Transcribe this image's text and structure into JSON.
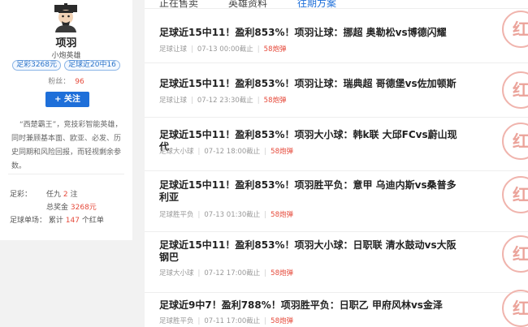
{
  "profile": {
    "name": "项羽",
    "role": "小炮英雄",
    "badges": [
      "足彩3268元",
      "足球近20中16"
    ],
    "fans_label": "粉丝：",
    "fans_count": "96",
    "follow_label": "+ 关注",
    "intro": "“西楚霸王”，竞技彩智能英雄，同时兼顾基本面、欧亚、必发、历史同期和风险回报，而轻视剩余参数。",
    "stats": {
      "zucai_label": "足彩：",
      "renjiu_prefix": "任九",
      "renjiu_count": "2",
      "renjiu_suffix": "注",
      "prize_label": "总奖金",
      "prize_value": "3268元",
      "single_label": "足球单场：",
      "single_prefix": "累计",
      "single_count": "147",
      "single_suffix": "个红单"
    }
  },
  "tabs": [
    "正在售卖",
    "英雄资料",
    "往期方案"
  ],
  "items": [
    {
      "title": "足球近15中11！盈利853%！项羽让球：挪超 奥勒松vs博德闪耀",
      "type": "足球让球",
      "time": "07-13 00:00截止",
      "price": "58炮弹",
      "stamp": "红"
    },
    {
      "title": "足球近15中11！盈利853%！项羽让球：瑞典超 哥德堡vs佐加顿斯",
      "type": "足球让球",
      "time": "07-12 23:30截止",
      "price": "58炮弹",
      "stamp": "红"
    },
    {
      "title": "足球近15中11！盈利853%！项羽大小球：韩k联 大邱FCvs蔚山现代",
      "type": "足球大小球",
      "time": "07-12 18:00截止",
      "price": "58炮弹",
      "stamp": "红"
    },
    {
      "title": "足球近15中11！盈利853%！项羽胜平负：意甲 乌迪内斯vs桑普多利亚",
      "type": "足球胜平负",
      "time": "07-13 01:30截止",
      "price": "58炮弹",
      "stamp": "红"
    },
    {
      "title": "足球近15中11！盈利853%！项羽大小球：日职联 清水鼓动vs大阪钢巴",
      "type": "足球大小球",
      "time": "07-12 17:00截止",
      "price": "58炮弹",
      "stamp": "红"
    },
    {
      "title": "足球近9中7！盈利788%！项羽胜平负：日职乙 甲府风林vs金泽",
      "type": "足球胜平负",
      "time": "07-11 17:00截止",
      "price": "58炮弹",
      "stamp": "红"
    }
  ],
  "colors": {
    "accent": "#1e6fd9",
    "price": "#e64a3b",
    "stamp": "#eba39a"
  }
}
